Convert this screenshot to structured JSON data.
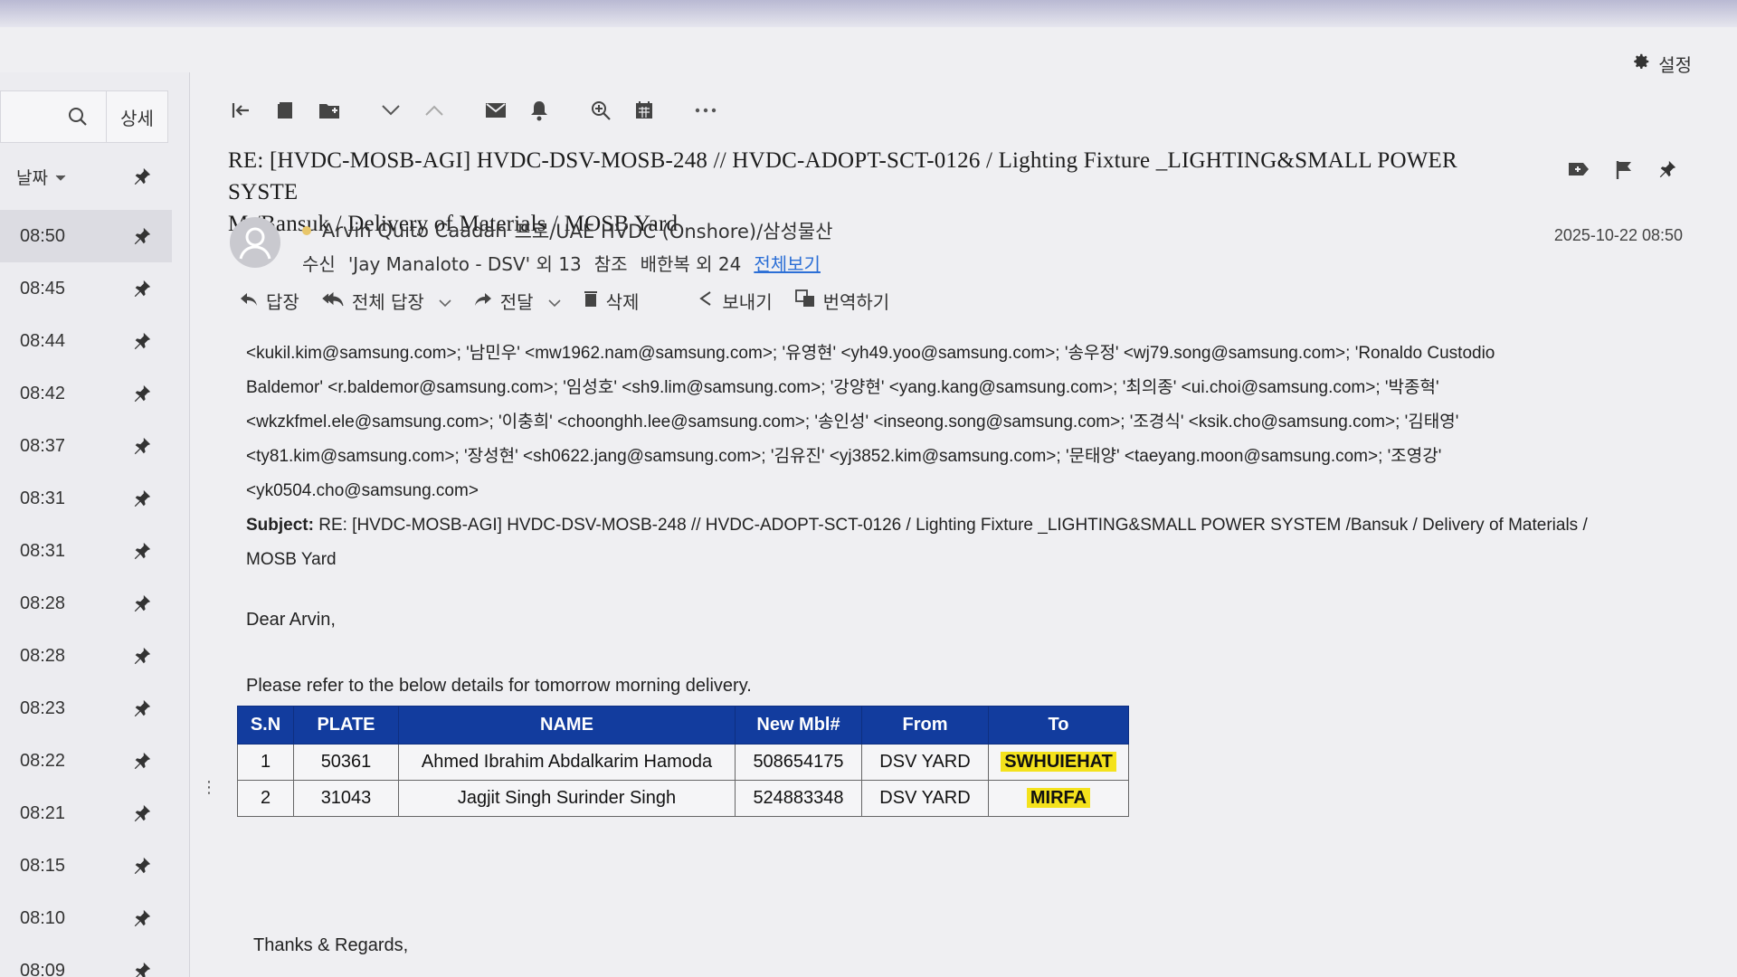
{
  "settings": {
    "label": "설정"
  },
  "left": {
    "detail_label": "상세",
    "sort_label": "날짜",
    "items": [
      {
        "time": "08:50"
      },
      {
        "time": "08:45"
      },
      {
        "time": "08:44"
      },
      {
        "time": "08:42"
      },
      {
        "time": "08:37"
      },
      {
        "time": "08:31"
      },
      {
        "time": "08:31"
      },
      {
        "time": "08:28"
      },
      {
        "time": "08:28"
      },
      {
        "time": "08:23"
      },
      {
        "time": "08:22"
      },
      {
        "time": "08:21"
      },
      {
        "time": "08:15"
      },
      {
        "time": "08:10"
      },
      {
        "time": "08:09"
      }
    ]
  },
  "mail": {
    "subject_line1": "RE: [HVDC-MOSB-AGI] HVDC-DSV-MOSB-248 // HVDC-ADOPT-SCT-0126 / Lighting Fixture _LIGHTING&SMALL POWER SYSTE",
    "subject_line2": "M /Bansuk / Delivery of Materials / MOSB Yard",
    "sender": "Arvin Quito Caadan",
    "sender_org": "프로/UAE HVDC (Onshore)/삼성물산",
    "recv_label": "수신",
    "recv_value": "'Jay Manaloto - DSV' 외 13",
    "cc_label": "참조",
    "cc_value": "배한복 외 24",
    "view_all": "전체보기",
    "date": "2025-10-22 08:50",
    "actions": {
      "reply": "답장",
      "reply_all": "전체 답장",
      "forward": "전달",
      "delete": "삭제",
      "send": "보내기",
      "translate": "번역하기"
    },
    "to_lines": [
      "<kukil.kim@samsung.com>; '남민우' <mw1962.nam@samsung.com>; '유영현' <yh49.yoo@samsung.com>; '송우정' <wj79.song@samsung.com>; 'Ronaldo Custodio",
      "Baldemor' <r.baldemor@samsung.com>; '임성호' <sh9.lim@samsung.com>; '강양현' <yang.kang@samsung.com>; '최의종' <ui.choi@samsung.com>; '박종혁'",
      "<wkzkfmel.ele@samsung.com>; '이충희' <choonghh.lee@samsung.com>; '송인성' <inseong.song@samsung.com>; '조경식' <ksik.cho@samsung.com>; '김태영'",
      "<ty81.kim@samsung.com>; '장성현' <sh0622.jang@samsung.com>; '김유진' <yj3852.kim@samsung.com>; '문태양' <taeyang.moon@samsung.com>; '조영강'",
      "<yk0504.cho@samsung.com>"
    ],
    "subject_label": "Subject:",
    "subject_body_line1": "RE: [HVDC-MOSB-AGI] HVDC-DSV-MOSB-248 // HVDC-ADOPT-SCT-0126 / Lighting Fixture _LIGHTING&SMALL POWER SYSTEM /Bansuk / Delivery of Materials /",
    "subject_body_line2": "MOSB Yard",
    "greeting": "Dear Arvin,",
    "refer": "Please refer to the below details for tomorrow morning delivery.",
    "table": {
      "headers": [
        "S.N",
        "PLATE",
        "NAME",
        "New Mbl#",
        "From",
        "To"
      ],
      "rows": [
        [
          "1",
          "50361",
          "Ahmed Ibrahim Abdalkarim Hamoda",
          "508654175",
          "DSV YARD",
          "SWHUIEHAT"
        ],
        [
          "2",
          "31043",
          "Jagjit Singh Surinder Singh",
          "524883348",
          "DSV YARD",
          "MIRFA"
        ]
      ]
    },
    "regards": "Thanks & Regards,"
  },
  "colors": {
    "table_header": "#123c9e",
    "highlight": "#f4e21c",
    "link": "#2c6fd6"
  }
}
